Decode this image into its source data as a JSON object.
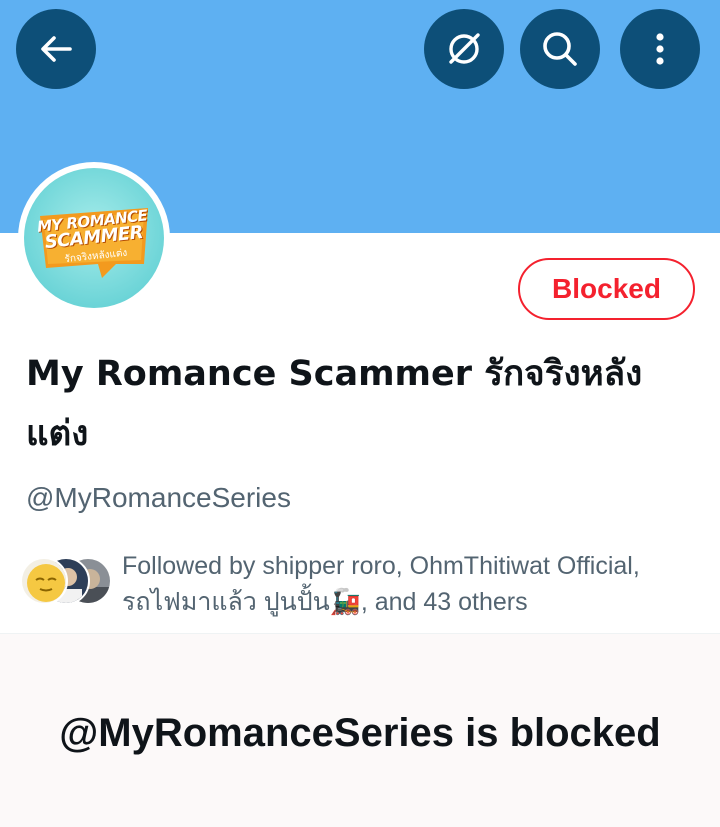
{
  "header": {
    "banner_color": "#5eb0f2",
    "button_color": "#0d4f78",
    "back_icon": "arrow-left-icon",
    "nocolor_icon": "circle-slash-icon",
    "search_icon": "search-icon",
    "more_icon": "more-vertical-icon"
  },
  "avatar": {
    "logo_line1": "MY ROMANCE",
    "logo_line2": "SCAMMER",
    "logo_line3": "รักจริงหลังแต่ง"
  },
  "profile": {
    "status_button": "Blocked",
    "display_name": "My Romance Scammer รักจริงหลังแต่ง",
    "handle": "@MyRomanceSeries",
    "followers_text": "Followed by shipper roro, OhmThitiwat Official, รถไฟมาแล้ว ปูนปั้น🚂, and 43 others"
  },
  "blocked_notice": {
    "title": "@MyRomanceSeries is blocked"
  },
  "colors": {
    "danger": "#f4212e",
    "text_primary": "#0f1419",
    "text_secondary": "#536471"
  }
}
